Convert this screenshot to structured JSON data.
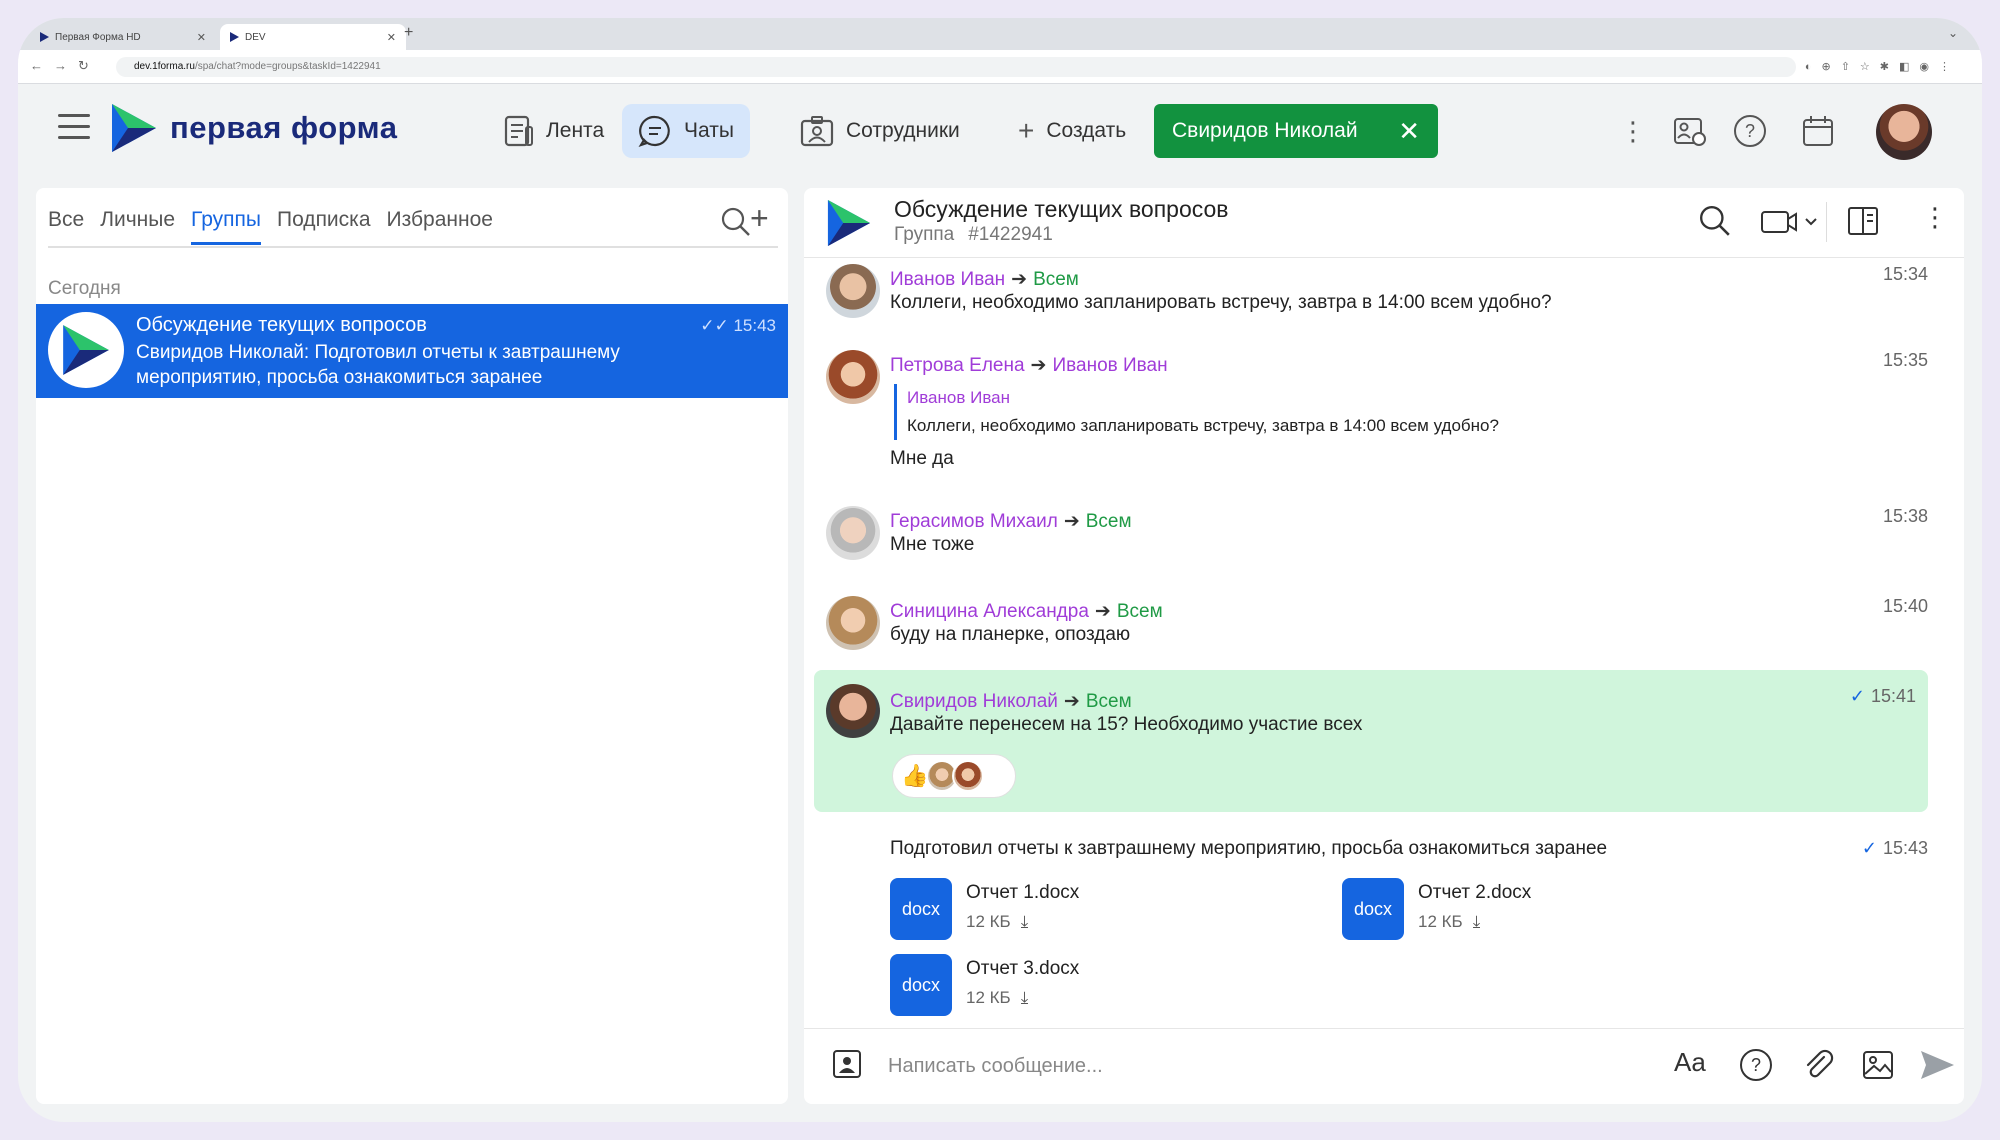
{
  "browser": {
    "tabs": [
      {
        "title": "Первая Форма HD"
      },
      {
        "title": "DEV"
      }
    ],
    "url_domain": "dev.1forma.ru",
    "url_path": "/spa/chat?mode=groups&taskId=1422941"
  },
  "header": {
    "logo_text": "первая форма",
    "nav": {
      "feed": "Лента",
      "chats": "Чаты",
      "staff": "Сотрудники",
      "create": "Создать"
    },
    "user_chip": "Свиридов Николай",
    "colors": {
      "brand_blue": "#1565e0",
      "chip_green": "#12923f",
      "active_nav": "#d6e6fb"
    }
  },
  "left": {
    "filters": [
      "Все",
      "Личные",
      "Группы",
      "Подписка",
      "Избранное"
    ],
    "active_filter": "Группы",
    "section": "Сегодня",
    "chat": {
      "title": "Обсуждение текущих вопросов",
      "preview": "Свиридов Николай: Подготовил отчеты к завтрашнему мероприятию, просьба ознакомиться заранее",
      "time": "15:43"
    }
  },
  "right": {
    "title": "Обсуждение текущих вопросов",
    "type": "Группа",
    "id": "#1422941",
    "messages": [
      {
        "author": "Иванов Иван",
        "to": "Всем",
        "to_group": true,
        "text": "Коллеги, необходимо запланировать встречу, завтра в 14:00 всем удобно?",
        "time": "15:34"
      },
      {
        "author": "Петрова Елена",
        "to": "Иванов Иван",
        "to_group": false,
        "quote_author": "Иванов Иван",
        "quote_text": "Коллеги, необходимо запланировать встречу, завтра в 14:00 всем удобно?",
        "text": "Мне да",
        "time": "15:35"
      },
      {
        "author": "Герасимов Михаил",
        "to": "Всем",
        "to_group": true,
        "text": "Мне тоже",
        "time": "15:38"
      },
      {
        "author": "Синицина Александра",
        "to": "Всем",
        "to_group": true,
        "text": "буду на планерке, опоздаю",
        "time": "15:40"
      },
      {
        "author": "Свиридов Николай",
        "to": "Всем",
        "to_group": true,
        "text": "Давайте перенесем на 15? Необходимо участие всех",
        "time": "15:41",
        "reaction": "👍"
      },
      {
        "text": "Подготовил отчеты к завтрашнему мероприятию, просьба ознакомиться заранее",
        "time": "15:43"
      }
    ],
    "files": [
      {
        "type": "docx",
        "name": "Отчет 1.docx",
        "size": "12 КБ"
      },
      {
        "type": "docx",
        "name": "Отчет 2.docx",
        "size": "12 КБ"
      },
      {
        "type": "docx",
        "name": "Отчет 3.docx",
        "size": "12 КБ"
      }
    ],
    "composer_placeholder": "Написать сообщение...",
    "composer_format": "Aa"
  }
}
